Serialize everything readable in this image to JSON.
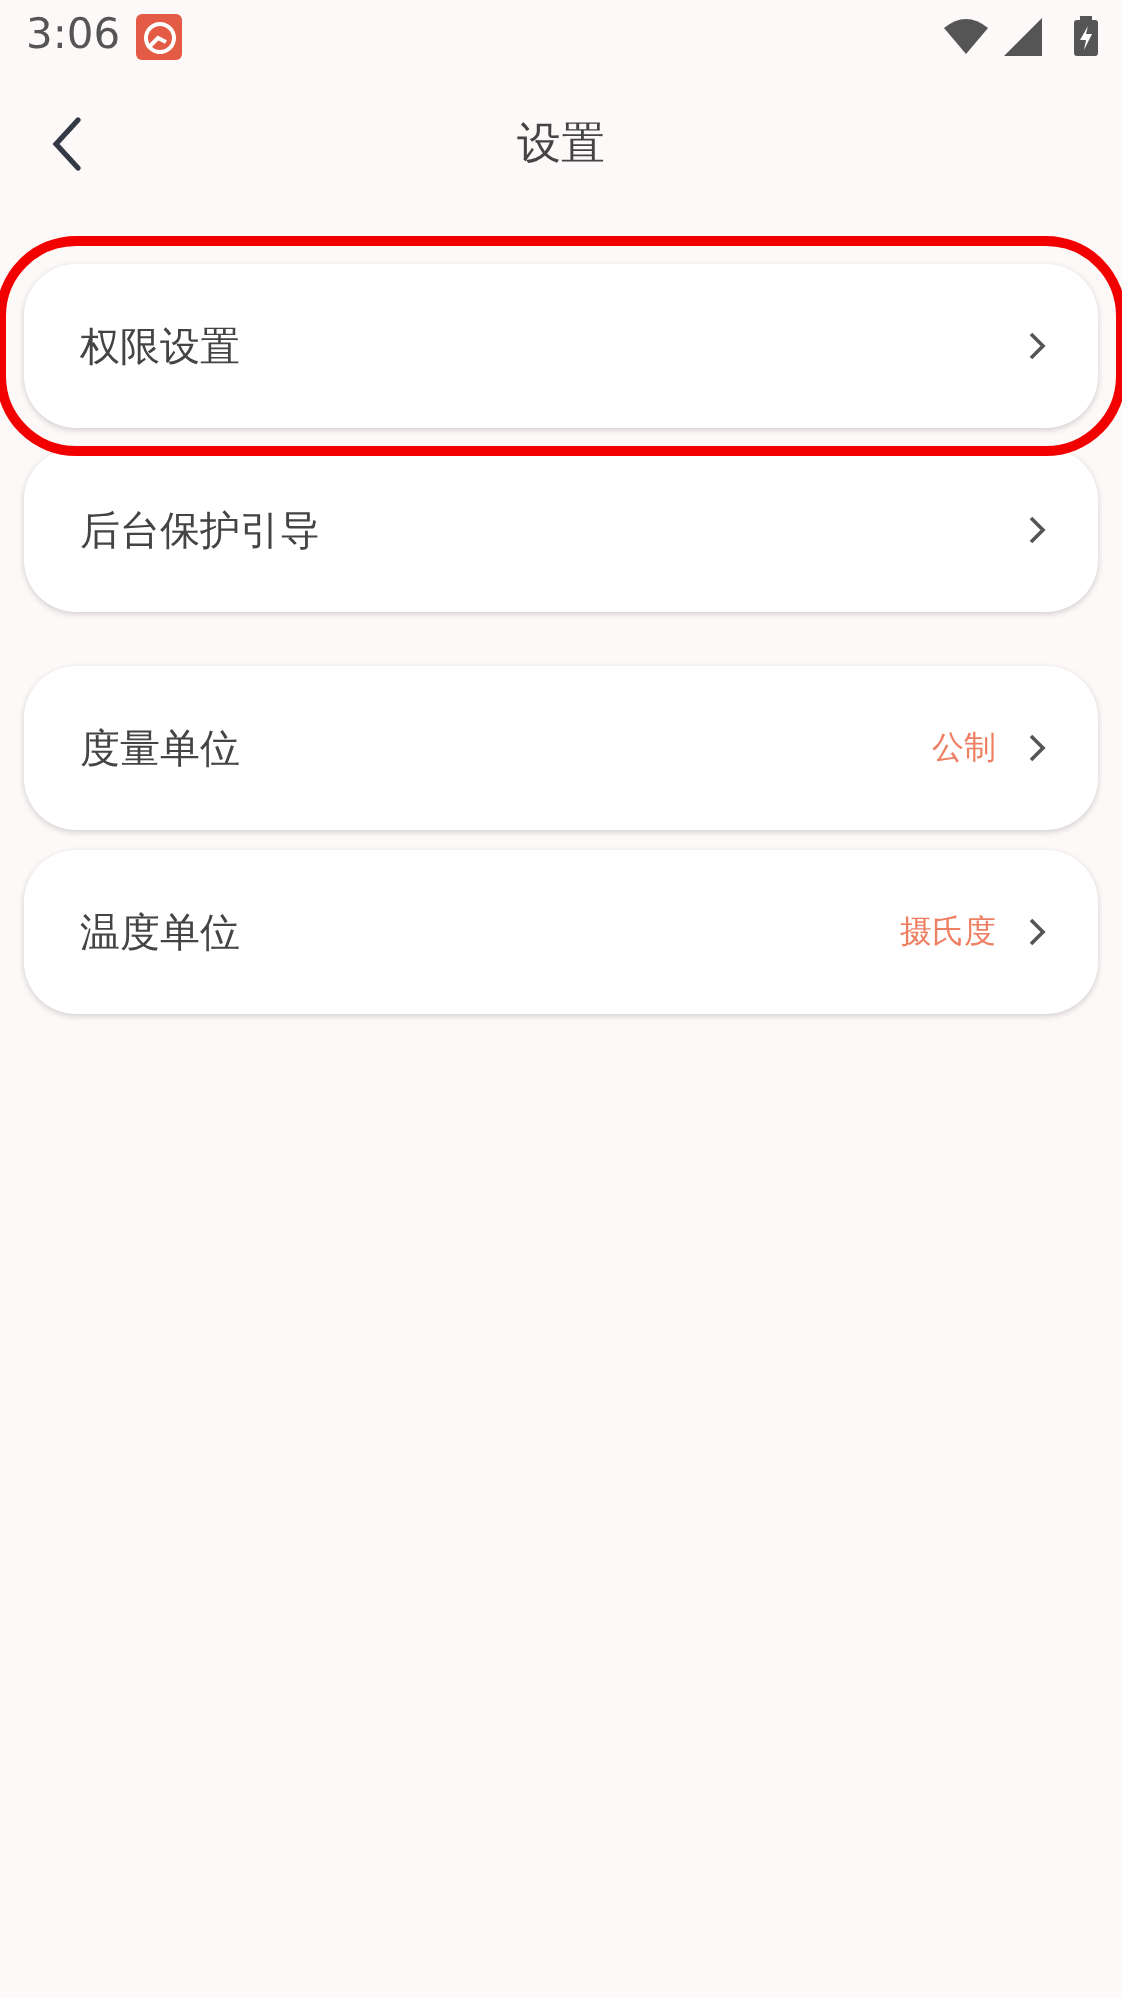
{
  "status_bar": {
    "time": "3:06"
  },
  "header": {
    "title": "设置"
  },
  "sections": [
    {
      "items": [
        {
          "label": "权限设置",
          "highlighted": true
        },
        {
          "label": "后台保护引导",
          "highlighted": false
        }
      ]
    },
    {
      "items": [
        {
          "label": "度量单位",
          "value": "公制",
          "highlighted": false
        },
        {
          "label": "温度单位",
          "value": "摄氏度",
          "highlighted": false
        }
      ]
    }
  ]
}
